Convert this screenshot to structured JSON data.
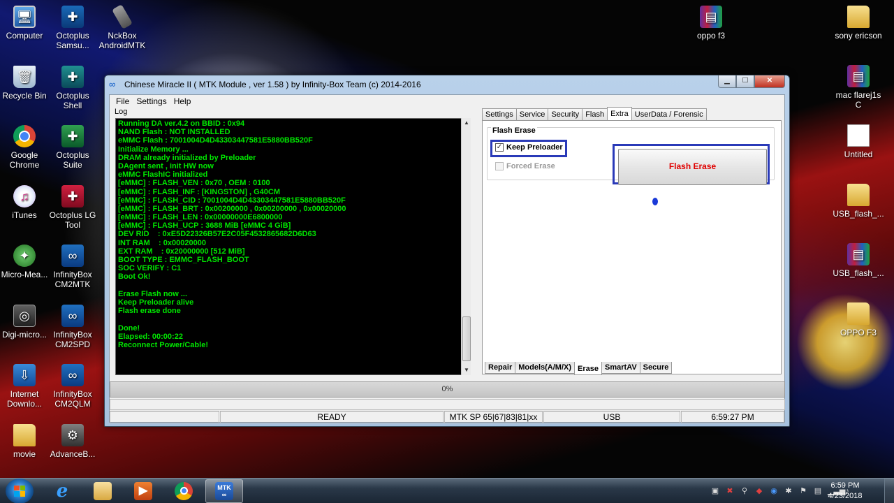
{
  "desktop": {
    "icons_left": [
      {
        "name": "computer",
        "label": "Computer",
        "glyph": "🖥",
        "cls": "computer"
      },
      {
        "name": "recycle-bin",
        "label": "Recycle Bin",
        "glyph": "🗑",
        "cls": "bin"
      },
      {
        "name": "google-chrome",
        "label": "Google Chrome",
        "glyph": "",
        "cls": "chrome"
      },
      {
        "name": "itunes",
        "label": "iTunes",
        "glyph": "♫",
        "cls": "itunes"
      },
      {
        "name": "micro-mea",
        "label": "Micro-Mea...",
        "glyph": "✦",
        "cls": "micro"
      },
      {
        "name": "digi-micro",
        "label": "Digi-micro...",
        "glyph": "◎",
        "cls": "digi"
      },
      {
        "name": "internet-downlo",
        "label": "Internet Downlo...",
        "glyph": "⇩",
        "cls": "internet"
      },
      {
        "name": "movie",
        "label": "movie",
        "glyph": "",
        "cls": "folder"
      }
    ],
    "icons_col2": [
      {
        "name": "octoplus-samsu",
        "label": "Octoplus Samsu...",
        "glyph": "✚",
        "cls": "octo"
      },
      {
        "name": "octoplus-shell",
        "label": "Octoplus Shell",
        "glyph": "✚",
        "cls": "octoshell"
      },
      {
        "name": "octoplus-suite",
        "label": "Octoplus Suite",
        "glyph": "✚",
        "cls": "octosuite"
      },
      {
        "name": "octoplus-lg-tool",
        "label": "Octoplus LG Tool",
        "glyph": "✚",
        "cls": "octolg"
      },
      {
        "name": "infinitybox-cm2mtk",
        "label": "InfinityBox CM2MTK",
        "glyph": "∞",
        "cls": "infinity"
      },
      {
        "name": "infinitybox-cm2spd",
        "label": "InfinityBox CM2SPD",
        "glyph": "∞",
        "cls": "infinity"
      },
      {
        "name": "infinitybox-cm2qlm",
        "label": "InfinityBox CM2QLM",
        "glyph": "∞",
        "cls": "infinity"
      },
      {
        "name": "advanceb",
        "label": "AdvanceB...",
        "glyph": "⚙",
        "cls": "advance"
      }
    ],
    "nckbox_label": "NckBox AndroidMTK",
    "icons_right": [
      {
        "name": "oppo-f3-rar",
        "label": "oppo f3",
        "glyph": "▤",
        "cls": "rar"
      },
      {
        "name": "sony-ericson",
        "label": "sony ericson",
        "glyph": "",
        "cls": "folder"
      },
      {
        "name": "mac-flarej1s",
        "label": "mac flarej1s C",
        "glyph": "▤",
        "cls": "rar"
      },
      {
        "name": "untitled",
        "label": "Untitled",
        "glyph": "",
        "cls": "doc"
      },
      {
        "name": "usb-flash-folder",
        "label": "USB_flash_...",
        "glyph": "",
        "cls": "folder"
      },
      {
        "name": "usb-flash-rar",
        "label": "USB_flash_...",
        "glyph": "▤",
        "cls": "rar"
      },
      {
        "name": "oppo-f3-folder",
        "label": "OPPO F3",
        "glyph": "",
        "cls": "folder"
      }
    ]
  },
  "window": {
    "title": "Chinese Miracle II ( MTK Module , ver 1.58 ) by Infinity-Box Team (c) 2014-2016",
    "menu": [
      "File",
      "Settings",
      "Help"
    ],
    "log_label": "Log",
    "log_lines": [
      "Running DA ver.4.2 on BBID : 0x94",
      "NAND Flash : NOT INSTALLED",
      "eMMC Flash : 7001004D4D43303447581E5880BB520F",
      "Initialize Memory ...",
      "DRAM already initialized by Preloader",
      "DAgent sent , init HW now",
      "eMMC FlashIC initialized",
      "[eMMC] : FLASH_VEN : 0x70 , OEM : 0100",
      "[eMMC] : FLASH_INF : [KINGSTON] , G40CM",
      "[eMMC] : FLASH_CID : 7001004D4D43303447581E5880BB520F",
      "[eMMC] : FLASH_BRT : 0x00200000 , 0x00200000 , 0x00020000",
      "[eMMC] : FLASH_LEN : 0x00000000E6800000",
      "[eMMC] : FLASH_UCP : 3688 MiB [eMMC 4 GiB]",
      "DEV RID    : 0xE5D22326B57E2C05F4532865682D6D63",
      "INT RAM    : 0x00020000",
      "EXT RAM    : 0x20000000 [512 MiB]",
      "BOOT TYPE : EMMC_FLASH_BOOT",
      "SOC VERIFY : C1",
      "Boot Ok!",
      "",
      "Erase Flash now ...",
      "Keep Preloader alive",
      "Flash erase done",
      "",
      "Done!",
      "Elapsed: 00:00:22",
      "Reconnect Power/Cable!"
    ],
    "top_tabs": [
      "Settings",
      "Service",
      "Security",
      "Flash",
      "Extra",
      "UserData / Forensic"
    ],
    "active_top_tab": "Extra",
    "group_title": "Flash Erase",
    "keep_preloader_label": "Keep Preloader",
    "keep_preloader_checked": true,
    "forced_erase_label": "Forced Erase",
    "forced_erase_checked": false,
    "flash_erase_button": "Flash Erase",
    "bottom_tabs": [
      "Repair",
      "Models(A/M/X)",
      "Erase",
      "SmartAV",
      "Secure"
    ],
    "active_bottom_tab": "Erase",
    "progress_text": "0%",
    "progress_value": 0,
    "status": {
      "state": "READY",
      "platform": "MTK SP 65|67|83|81|xx",
      "connection": "USB",
      "time": "6:59:27 PM"
    }
  },
  "taskbar": {
    "clock_time": "6:59 PM",
    "clock_date": "4/23/2018",
    "mtk_label": "MTK"
  },
  "colors": {
    "log_text": "#00e600",
    "flash_button_text": "#e00000",
    "highlight_border": "#2a3ab8"
  }
}
